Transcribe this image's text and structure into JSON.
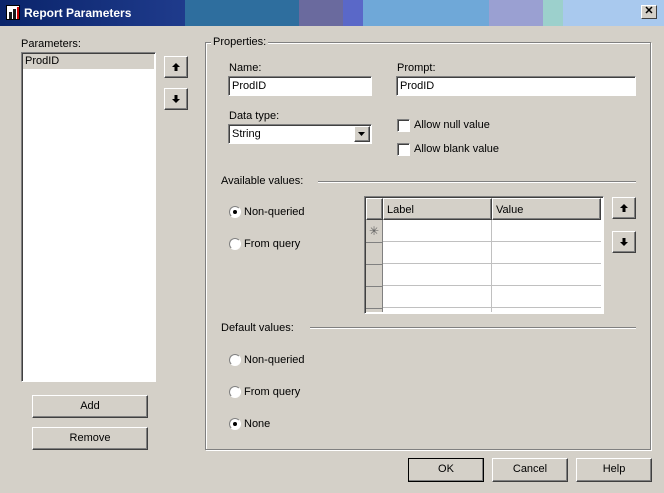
{
  "window": {
    "title": "Report Parameters",
    "close_glyph": "✕"
  },
  "parameters": {
    "label": "Parameters:",
    "items": [
      "ProdID"
    ]
  },
  "properties": {
    "group_label": "Properties:",
    "name_label": "Name:",
    "name_value": "ProdID",
    "prompt_label": "Prompt:",
    "prompt_value": "ProdID",
    "datatype_label": "Data type:",
    "datatype_value": "String",
    "allow_null_label": "Allow null value",
    "allow_blank_label": "Allow blank value",
    "allow_null_checked": false,
    "allow_blank_checked": false
  },
  "available_values": {
    "label": "Available values:",
    "options": [
      "Non-queried",
      "From query"
    ],
    "selected": "Non-queried",
    "grid_headers": [
      "Label",
      "Value"
    ],
    "new_row_glyph": "✳"
  },
  "default_values": {
    "label": "Default values:",
    "options": [
      "Non-queried",
      "From query",
      "None"
    ],
    "selected": "None"
  },
  "buttons": {
    "add": "Add",
    "remove": "Remove",
    "ok": "OK",
    "cancel": "Cancel",
    "help": "Help"
  },
  "icons": [
    "move-up-icon",
    "move-down-icon",
    "dropdown-arrow-icon",
    "report-app-icon",
    "close-icon"
  ],
  "colors": {
    "title_start": "#0a246a",
    "dialog_bg": "#d4d0c8",
    "title_text": "#ffffff"
  }
}
